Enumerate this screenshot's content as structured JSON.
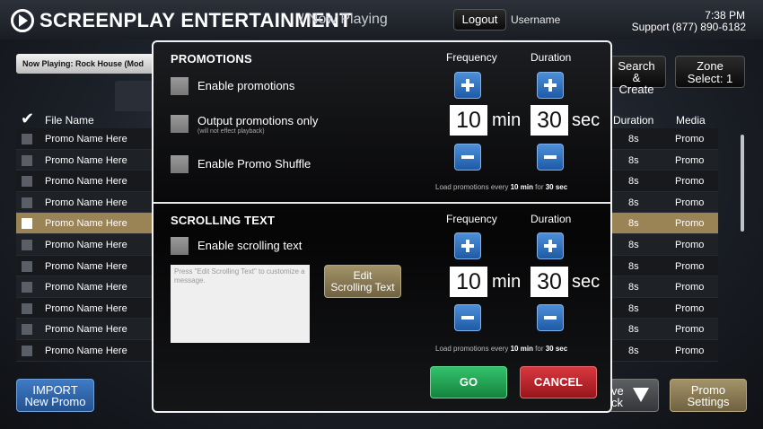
{
  "header": {
    "brand": "SCREENPLAY ENTERTAINMENT",
    "breadcrumb": "/ Now Playing",
    "logout_label": "Logout",
    "username": "Username",
    "time": "7:38 PM",
    "support": "Support (877) 890-6182"
  },
  "now_playing": "Now Playing:  Rock House (Mod",
  "toolbar": {
    "search_line1": "Search &",
    "search_line2": "Create",
    "zone_line1": "Zone",
    "zone_line2": "Select: 1"
  },
  "table": {
    "columns": {
      "file_name": "File Name",
      "duration": "Duration",
      "media": "Media"
    },
    "check_glyph": "✔",
    "rows": [
      {
        "name": "Promo Name Here",
        "duration": "8s",
        "media": "Promo",
        "selected": false
      },
      {
        "name": "Promo Name Here",
        "duration": "8s",
        "media": "Promo",
        "selected": false
      },
      {
        "name": "Promo Name Here",
        "duration": "8s",
        "media": "Promo",
        "selected": false
      },
      {
        "name": "Promo Name Here",
        "duration": "8s",
        "media": "Promo",
        "selected": false
      },
      {
        "name": "Promo Name Here",
        "duration": "8s",
        "media": "Promo",
        "selected": true
      },
      {
        "name": "Promo Name Here",
        "duration": "8s",
        "media": "Promo",
        "selected": false
      },
      {
        "name": "Promo Name Here",
        "duration": "8s",
        "media": "Promo",
        "selected": false
      },
      {
        "name": "Promo Name Here",
        "duration": "8s",
        "media": "Promo",
        "selected": false
      },
      {
        "name": "Promo Name Here",
        "duration": "8s",
        "media": "Promo",
        "selected": false
      },
      {
        "name": "Promo Name Here",
        "duration": "8s",
        "media": "Promo",
        "selected": false
      },
      {
        "name": "Promo Name Here",
        "duration": "8s",
        "media": "Promo",
        "selected": false
      }
    ]
  },
  "footer": {
    "import_line1": "IMPORT",
    "import_line2": "New Promo",
    "save_line1": "ve",
    "save_line2": "ck",
    "promo_settings_line1": "Promo",
    "promo_settings_line2": "Settings"
  },
  "modal": {
    "promotions": {
      "title": "PROMOTIONS",
      "frequency_header": "Frequency",
      "duration_header": "Duration",
      "enable_label": "Enable promotions",
      "output_only_label": "Output promotions only",
      "output_only_note": "(will not effect playback)",
      "shuffle_label": "Enable Promo Shuffle",
      "frequency_value": "10",
      "frequency_unit": "min",
      "duration_value": "30",
      "duration_unit": "sec",
      "note_prefix": "Load promotions every ",
      "note_freq": "10 min",
      "note_mid": " for ",
      "note_dur": "30 sec"
    },
    "scrolling": {
      "title": "SCROLLING TEXT",
      "frequency_header": "Frequency",
      "duration_header": "Duration",
      "enable_label": "Enable scrolling text",
      "textarea_placeholder": "Press \"Edit Scrolling Text\" to customize a message.",
      "edit_line1": "Edit",
      "edit_line2": "Scrolling Text",
      "frequency_value": "10",
      "frequency_unit": "min",
      "duration_value": "30",
      "duration_unit": "sec",
      "note_prefix": "Load promotions every ",
      "note_freq": "10 min",
      "note_mid": " for ",
      "note_dur": "30 sec"
    },
    "go_label": "GO",
    "cancel_label": "CANCEL"
  }
}
